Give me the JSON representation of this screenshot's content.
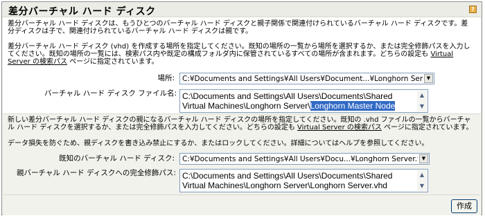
{
  "header": {
    "title": "差分バーチャル ハード ディスク",
    "help_icon": "help-icon"
  },
  "section1": {
    "para1": "差分バーチャル ハード ディスクは、もうひとつのバーチャル ハード ディスクと親子関係で関連付けられているバーチャル ハード ディスクです。差分ディスクは子で、関連付けられているバーチャル ハード ディスクは親です。",
    "para2_a": "差分バーチャル ハード ディスク (vhd) を作成する場所を指定してください。既知の場所の一覧から場所を選択するか、または完全修飾パスを入力してください。既知の場所の一覧には、検索パス内や既定の構成フォルダ内に保管されているすべての場所が含まれます。どちらの設定も ",
    "para2_link": "Virtual Server の検索パス",
    "para2_b": " ページに指定されています。",
    "location_label": "場所:",
    "location_value": "C:¥Documents and Settings¥All Users¥Document...¥Longhorn Server",
    "filename_label": "バーチャル ハード ディスク ファイル名:",
    "filename_line1": "C:\\Documents and Settings\\All Users\\Documents\\Shared",
    "filename_line2_a": "Virtual Machines\\Longhorn Server\\",
    "filename_line2_selected": "Longhorn Master Node"
  },
  "section2": {
    "para1_a": "新しい差分バーチャル ハード ディスクの親になるバーチャル ハード ディスクの場所を指定してください。既知の .vhd ファイルの一覧からバーチャル ハード ディスクを選択するか、または完全修飾パスを入力してください。どちらの設定も ",
    "para1_link": "Virtual Server の検索パス",
    "para1_b": " ページに指定されています。",
    "para2": "データ損失を防ぐため、親ディスクを書き込み禁止にするか、またはロックしてください。詳細についてはヘルプを参照してください。",
    "known_label": "既知のバーチャル ハード ディスク:",
    "known_value": "C:¥Documents and Settings¥All Users¥Docu...¥Longhorn Server.vhd",
    "parent_label": "親バーチャル ハード ディスクへの完全修飾パス:",
    "parent_line1": "C:\\Documents and Settings\\All Users\\Documents\\Shared",
    "parent_line2": "Virtual Machines\\Longhorn Server\\Longhorn Server.vhd"
  },
  "footer": {
    "create_label": "作成"
  },
  "colors": {
    "selection": "#316ac5",
    "input_border": "#7f9db9",
    "panel_bg": "#f2f2ec",
    "button_border": "#003c74"
  }
}
